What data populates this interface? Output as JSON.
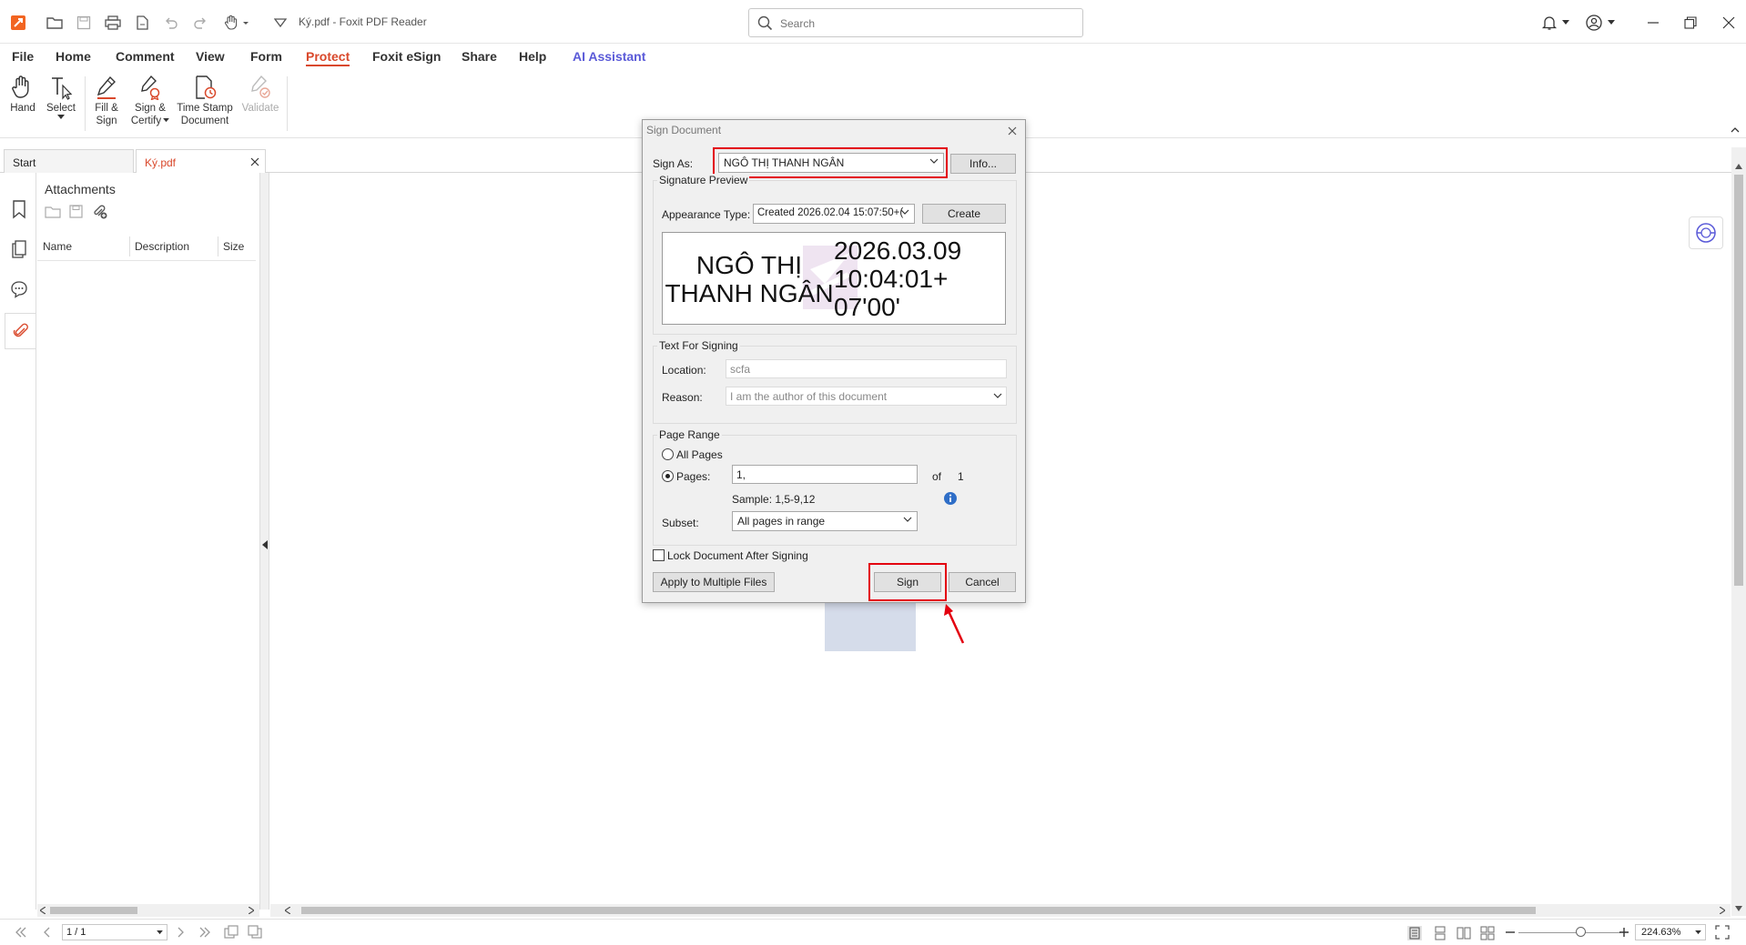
{
  "app": {
    "title": "Ký.pdf - Foxit PDF Reader"
  },
  "search": {
    "placeholder": "Search"
  },
  "menu": [
    "File",
    "Home",
    "Comment",
    "View",
    "Form",
    "Protect",
    "Foxit eSign",
    "Share",
    "Help",
    "AI Assistant"
  ],
  "ribbon": {
    "hand": "Hand",
    "select": "Select",
    "fill_sign": [
      "Fill &",
      "Sign"
    ],
    "sign_certify": [
      "Sign &",
      "Certify"
    ],
    "time_stamp": [
      "Time Stamp",
      "Document"
    ],
    "validate": "Validate"
  },
  "tabs": {
    "start": "Start",
    "doc": "Ký.pdf"
  },
  "attachments": {
    "title": "Attachments",
    "columns": [
      "Name",
      "Description",
      "Size"
    ]
  },
  "dialog": {
    "title": "Sign Document",
    "sign_as_label": "Sign As:",
    "sign_as_value": "NGÔ THỊ THANH NGÂN",
    "info_button": "Info...",
    "preview_group": "Signature Preview",
    "appearance_label": "Appearance Type:",
    "appearance_value": "Created 2026.02.04 15:07:50+(",
    "create_button": "Create",
    "signature_name": "NGÔ THỊ THANH NGÂN",
    "signature_date": "2026.03.09 10:04:01+ 07'00'",
    "text_group": "Text For Signing",
    "location_label": "Location:",
    "location_value": "scfa",
    "reason_label": "Reason:",
    "reason_value": "I am the author of this document",
    "page_range_group": "Page Range",
    "all_pages_label": "All Pages",
    "pages_label": "Pages:",
    "pages_value": "1,",
    "of_label": "of",
    "total_pages": "1",
    "sample_text": "Sample: 1,5-9,12",
    "subset_label": "Subset:",
    "subset_value": "All pages in range",
    "lock_label": "Lock Document After Signing",
    "apply_multiple_button": "Apply to Multiple Files",
    "sign_button": "Sign",
    "cancel_button": "Cancel"
  },
  "status": {
    "page": "1 / 1",
    "zoom": "224.63%"
  },
  "colors": {
    "accent": "#d9482b",
    "ai": "#5a5ad8",
    "highlight": "#e3000f"
  }
}
